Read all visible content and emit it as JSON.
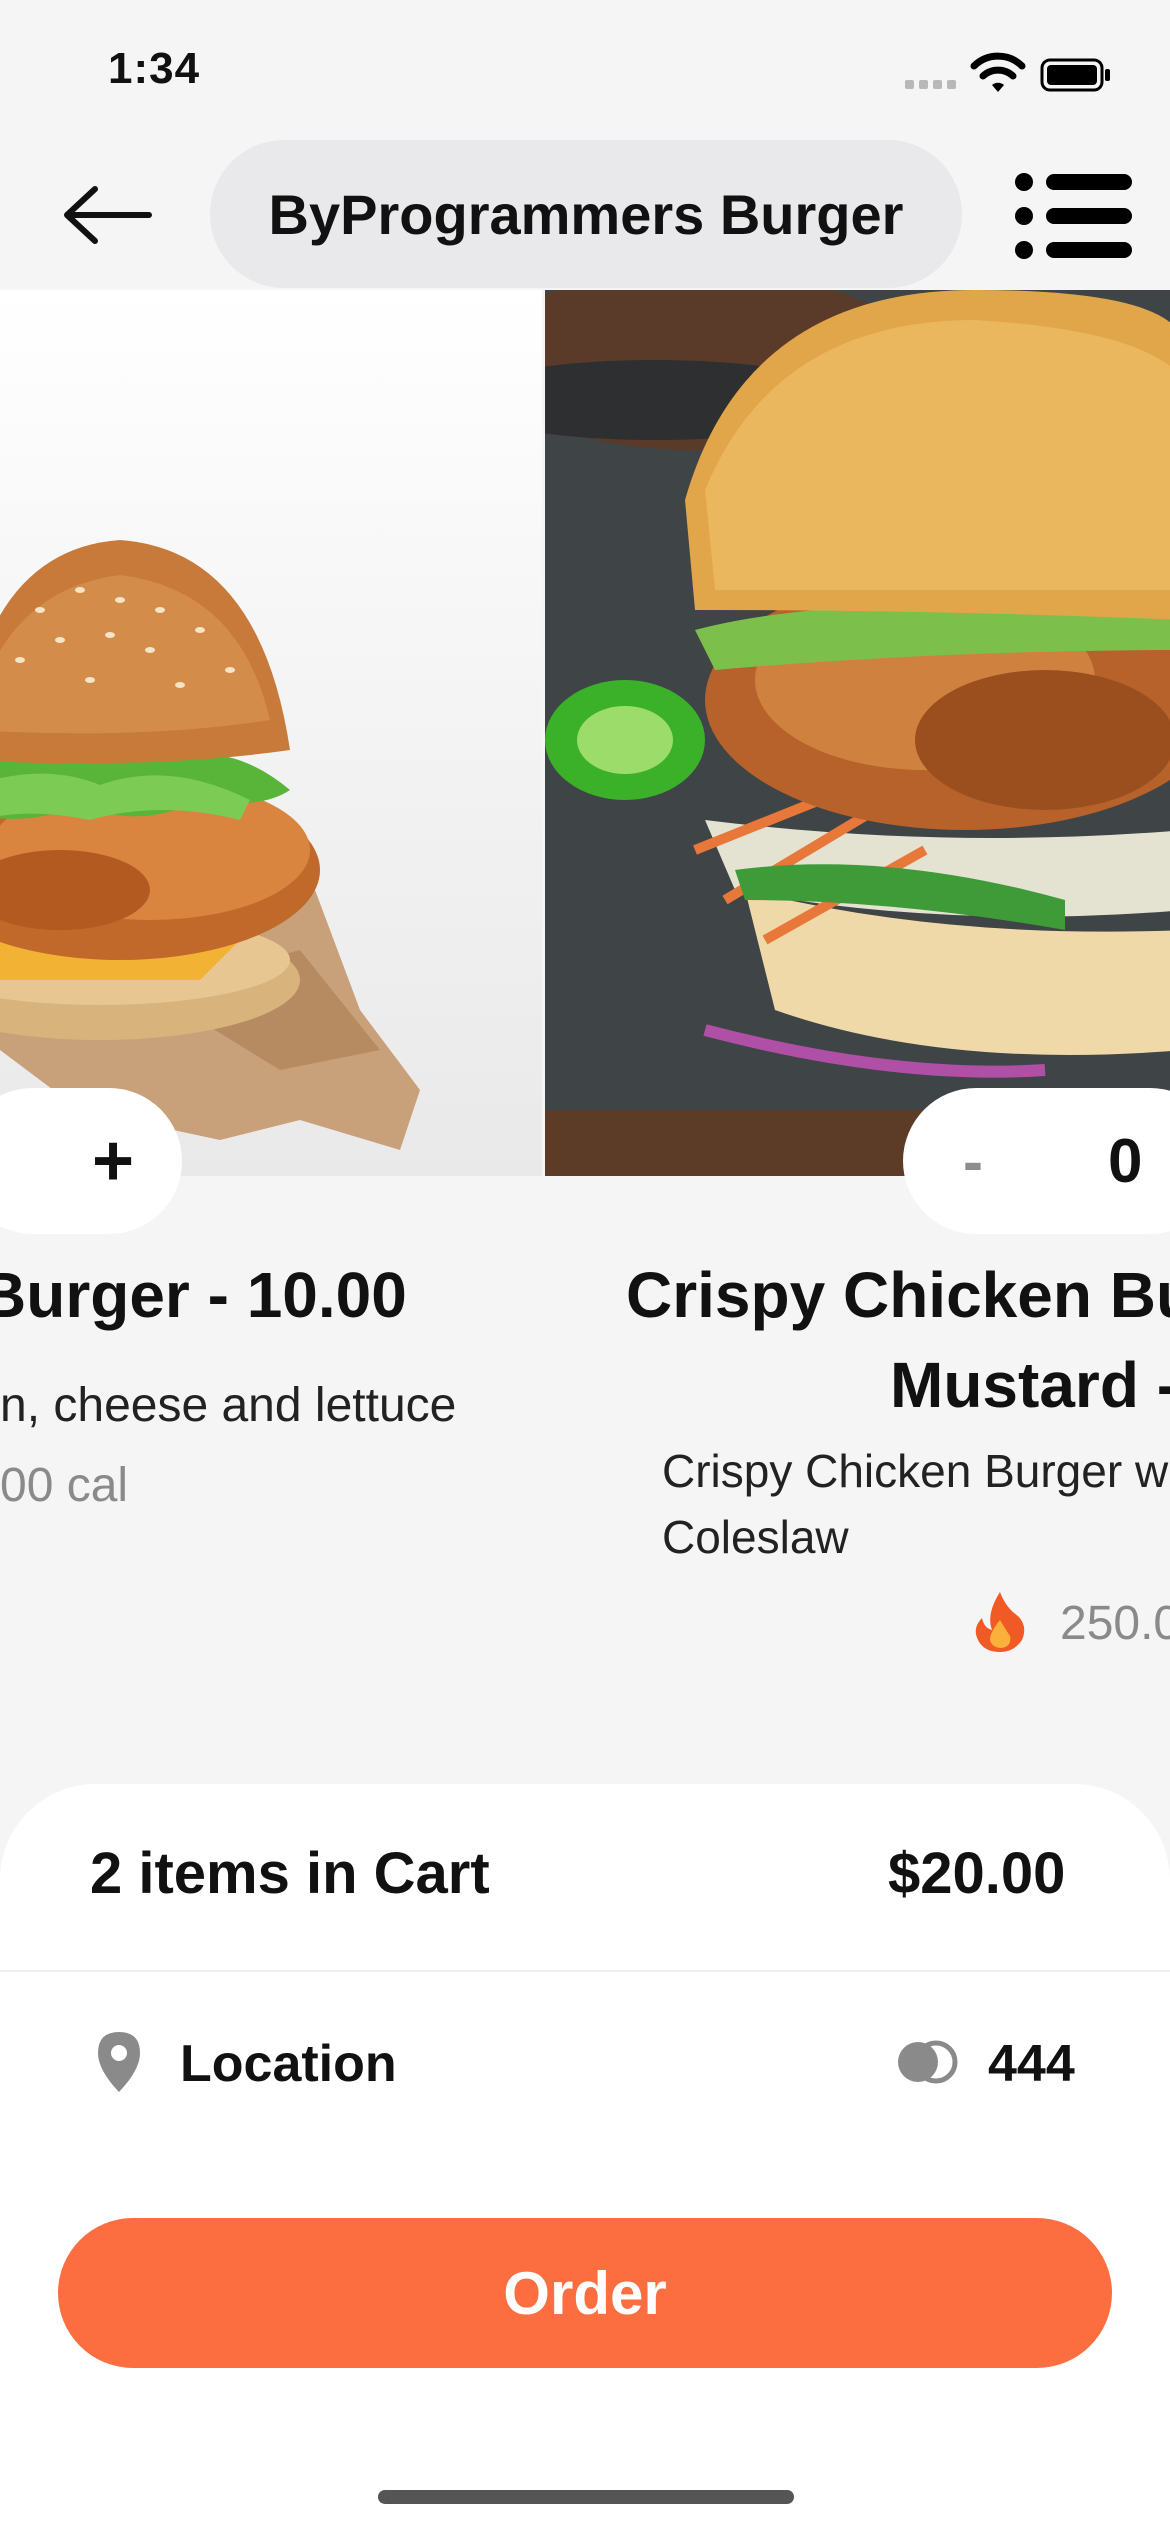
{
  "status_bar": {
    "time": "1:34"
  },
  "header": {
    "title": "ByProgrammers Burger",
    "back_icon": "arrow-left-icon",
    "menu_icon": "list-icon"
  },
  "carousel": {
    "items": [
      {
        "name": "Burger - 10.00",
        "description": "n, cheese and lettuce",
        "calories": "00 cal",
        "action": "+"
      },
      {
        "name_line1": "Crispy Chicken Bu",
        "name_line2": "Mustard -",
        "description": "Crispy Chicken Burger w Coleslaw",
        "calories": "250.0",
        "minus": "-",
        "quantity": "0"
      }
    ],
    "page_count": 3,
    "active_page": 1
  },
  "cart": {
    "items_label": "2 items in Cart",
    "total": "$20.00",
    "location_label": "Location",
    "points": "444",
    "order_label": "Order"
  },
  "colors": {
    "accent": "#fc6d3f",
    "dot_active": "#d4a7a1",
    "dot_inactive": "#e6e6e6"
  }
}
